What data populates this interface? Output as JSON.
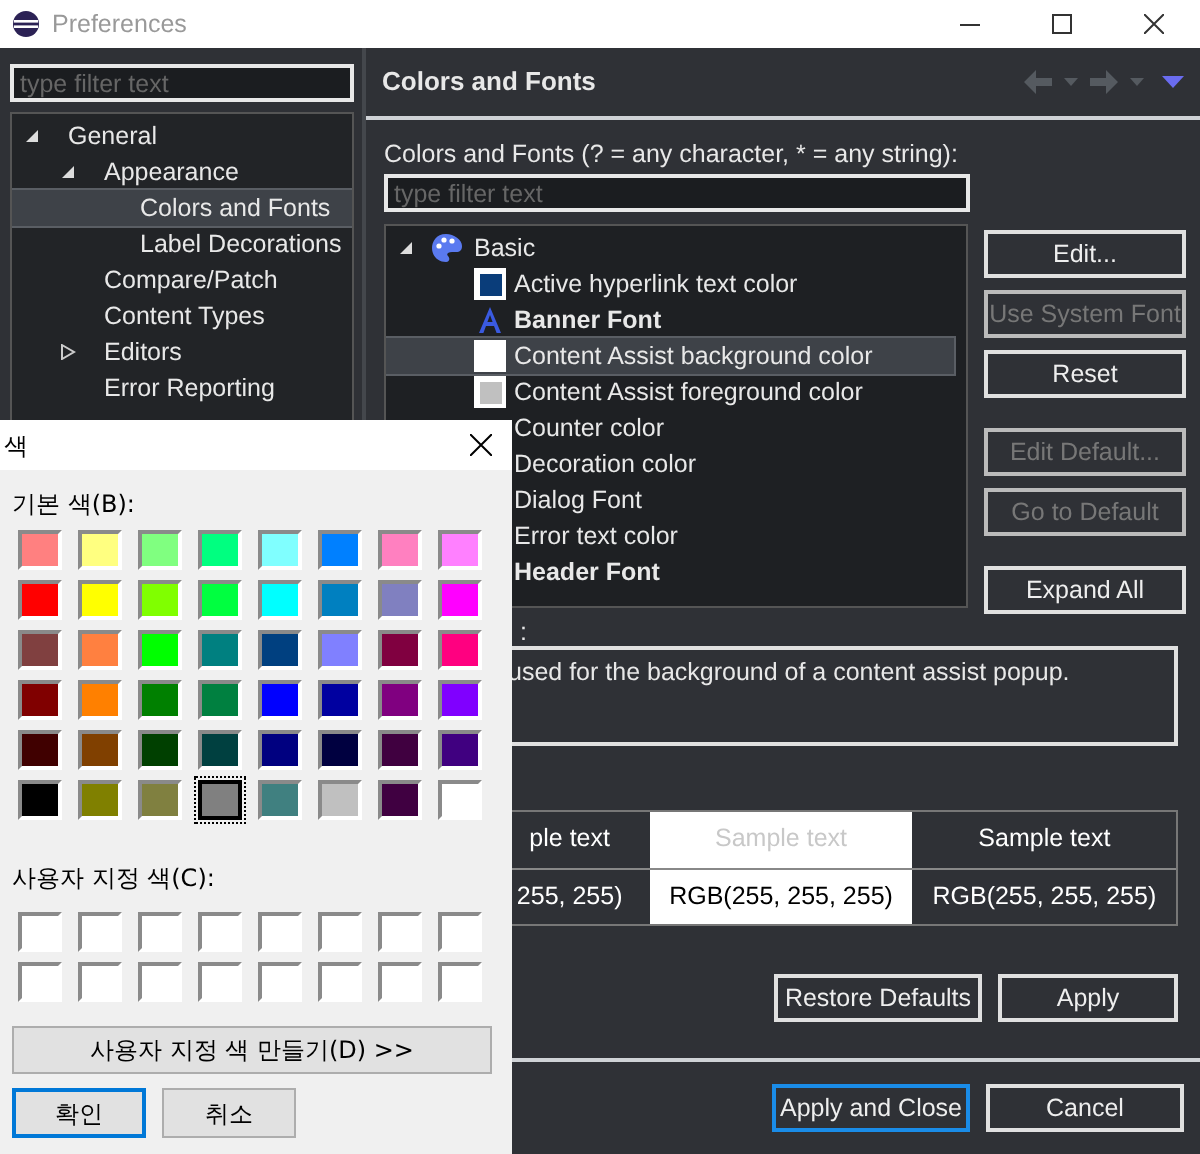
{
  "window": {
    "title": "Preferences"
  },
  "filter": {
    "placeholder": "type filter text"
  },
  "nav_tree": [
    {
      "label": "General",
      "expanded": true,
      "selected": false,
      "children": [
        {
          "label": "Appearance",
          "expanded": true,
          "selected": false,
          "children": [
            {
              "label": "Colors and Fonts",
              "selected": true
            },
            {
              "label": "Label Decorations",
              "selected": false
            }
          ]
        },
        {
          "label": "Compare/Patch",
          "selected": false
        },
        {
          "label": "Content Types",
          "selected": false
        },
        {
          "label": "Editors",
          "expanded": false,
          "selected": false
        },
        {
          "label": "Error Reporting",
          "selected": false
        }
      ]
    }
  ],
  "page": {
    "title": "Colors and Fonts",
    "filter_label": "Colors and Fonts (? = any character, * = any string):",
    "filter": {
      "placeholder": "type filter text"
    },
    "tree": [
      {
        "label": "Basic",
        "kind": "category",
        "expanded": true,
        "children": [
          {
            "label": "Active hyperlink text color",
            "kind": "color",
            "color": "#0a3d7a",
            "bold": false,
            "selected": false
          },
          {
            "label": "Banner Font",
            "kind": "font",
            "bold": true,
            "selected": false
          },
          {
            "label": "Content Assist background color",
            "kind": "color",
            "color": "#ffffff",
            "bold": false,
            "selected": true
          },
          {
            "label": "Content Assist foreground color",
            "kind": "color",
            "color": "#c0c0c0",
            "bold": false,
            "selected": false
          },
          {
            "label": "Counter color",
            "kind": "covered",
            "bold": false,
            "selected": false
          },
          {
            "label": "Decoration color",
            "kind": "covered",
            "bold": false,
            "selected": false
          },
          {
            "label": "Dialog Font",
            "kind": "covered",
            "bold": false,
            "selected": false
          },
          {
            "label": "Error text color",
            "kind": "covered",
            "bold": false,
            "selected": false
          },
          {
            "label": "Header Font",
            "kind": "covered",
            "bold": true,
            "selected": false
          }
        ]
      }
    ],
    "button_groups": [
      [
        {
          "label": "Edit...",
          "disabled": false
        },
        {
          "label": "Use System Font",
          "disabled": true
        },
        {
          "label": "Reset",
          "disabled": false
        }
      ],
      [
        {
          "label": "Edit Default...",
          "disabled": true
        },
        {
          "label": "Go to Default",
          "disabled": true
        }
      ],
      [
        {
          "label": "Expand All",
          "disabled": false
        }
      ]
    ],
    "description_label": ":",
    "description": "used for the background of a content assist popup.",
    "preview": [
      {
        "sample": "ple text",
        "value": "255, 255)",
        "kind": "dark"
      },
      {
        "sample": "Sample text",
        "value": "RGB(255, 255, 255)",
        "kind": "light"
      },
      {
        "sample": "Sample text",
        "value": "RGB(255, 255, 255)",
        "kind": "dark"
      }
    ],
    "actions": [
      {
        "label": "Restore Defaults"
      },
      {
        "label": "Apply"
      }
    ]
  },
  "footer_buttons": [
    {
      "label": "Apply and Close",
      "default": true
    },
    {
      "label": "Cancel",
      "default": false
    }
  ],
  "color_dialog": {
    "title": "색",
    "basic_label": "기본 색(B):",
    "basic_colors": [
      {
        "color": "#ff8080",
        "selected": false
      },
      {
        "color": "#ffff80",
        "selected": false
      },
      {
        "color": "#80ff80",
        "selected": false
      },
      {
        "color": "#00ff80",
        "selected": false
      },
      {
        "color": "#80ffff",
        "selected": false
      },
      {
        "color": "#0080ff",
        "selected": false
      },
      {
        "color": "#ff80c0",
        "selected": false
      },
      {
        "color": "#ff80ff",
        "selected": false
      },
      {
        "color": "#ff0000",
        "selected": false
      },
      {
        "color": "#ffff00",
        "selected": false
      },
      {
        "color": "#80ff00",
        "selected": false
      },
      {
        "color": "#00ff40",
        "selected": false
      },
      {
        "color": "#00ffff",
        "selected": false
      },
      {
        "color": "#0080c0",
        "selected": false
      },
      {
        "color": "#8080c0",
        "selected": false
      },
      {
        "color": "#ff00ff",
        "selected": false
      },
      {
        "color": "#804040",
        "selected": false
      },
      {
        "color": "#ff8040",
        "selected": false
      },
      {
        "color": "#00ff00",
        "selected": false
      },
      {
        "color": "#008080",
        "selected": false
      },
      {
        "color": "#004080",
        "selected": false
      },
      {
        "color": "#8080ff",
        "selected": false
      },
      {
        "color": "#800040",
        "selected": false
      },
      {
        "color": "#ff0080",
        "selected": false
      },
      {
        "color": "#800000",
        "selected": false
      },
      {
        "color": "#ff8000",
        "selected": false
      },
      {
        "color": "#008000",
        "selected": false
      },
      {
        "color": "#008040",
        "selected": false
      },
      {
        "color": "#0000ff",
        "selected": false
      },
      {
        "color": "#0000a0",
        "selected": false
      },
      {
        "color": "#800080",
        "selected": false
      },
      {
        "color": "#8000ff",
        "selected": false
      },
      {
        "color": "#400000",
        "selected": false
      },
      {
        "color": "#804000",
        "selected": false
      },
      {
        "color": "#004000",
        "selected": false
      },
      {
        "color": "#004040",
        "selected": false
      },
      {
        "color": "#000080",
        "selected": false
      },
      {
        "color": "#000040",
        "selected": false
      },
      {
        "color": "#400040",
        "selected": false
      },
      {
        "color": "#400080",
        "selected": false
      },
      {
        "color": "#000000",
        "selected": false
      },
      {
        "color": "#808000",
        "selected": false
      },
      {
        "color": "#808040",
        "selected": false
      },
      {
        "color": "#808080",
        "selected": true
      },
      {
        "color": "#408080",
        "selected": false
      },
      {
        "color": "#c0c0c0",
        "selected": false
      },
      {
        "color": "#400041",
        "selected": false
      },
      {
        "color": "#ffffff",
        "selected": false
      }
    ],
    "custom_label": "사용자 지정 색(C):",
    "custom_colors": [
      {
        "color": "#ffffff",
        "selected": false
      },
      {
        "color": "#ffffff",
        "selected": false
      },
      {
        "color": "#ffffff",
        "selected": false
      },
      {
        "color": "#ffffff",
        "selected": false
      },
      {
        "color": "#ffffff",
        "selected": false
      },
      {
        "color": "#ffffff",
        "selected": false
      },
      {
        "color": "#ffffff",
        "selected": false
      },
      {
        "color": "#ffffff",
        "selected": false
      },
      {
        "color": "#ffffff",
        "selected": false
      },
      {
        "color": "#ffffff",
        "selected": false
      },
      {
        "color": "#ffffff",
        "selected": false
      },
      {
        "color": "#ffffff",
        "selected": false
      },
      {
        "color": "#ffffff",
        "selected": false
      },
      {
        "color": "#ffffff",
        "selected": false
      },
      {
        "color": "#ffffff",
        "selected": false
      },
      {
        "color": "#ffffff",
        "selected": false
      }
    ],
    "define_button": "사용자 지정 색 만들기(D) >>",
    "buttons": [
      {
        "label": "확인",
        "default": true
      },
      {
        "label": "취소",
        "default": false
      }
    ]
  }
}
